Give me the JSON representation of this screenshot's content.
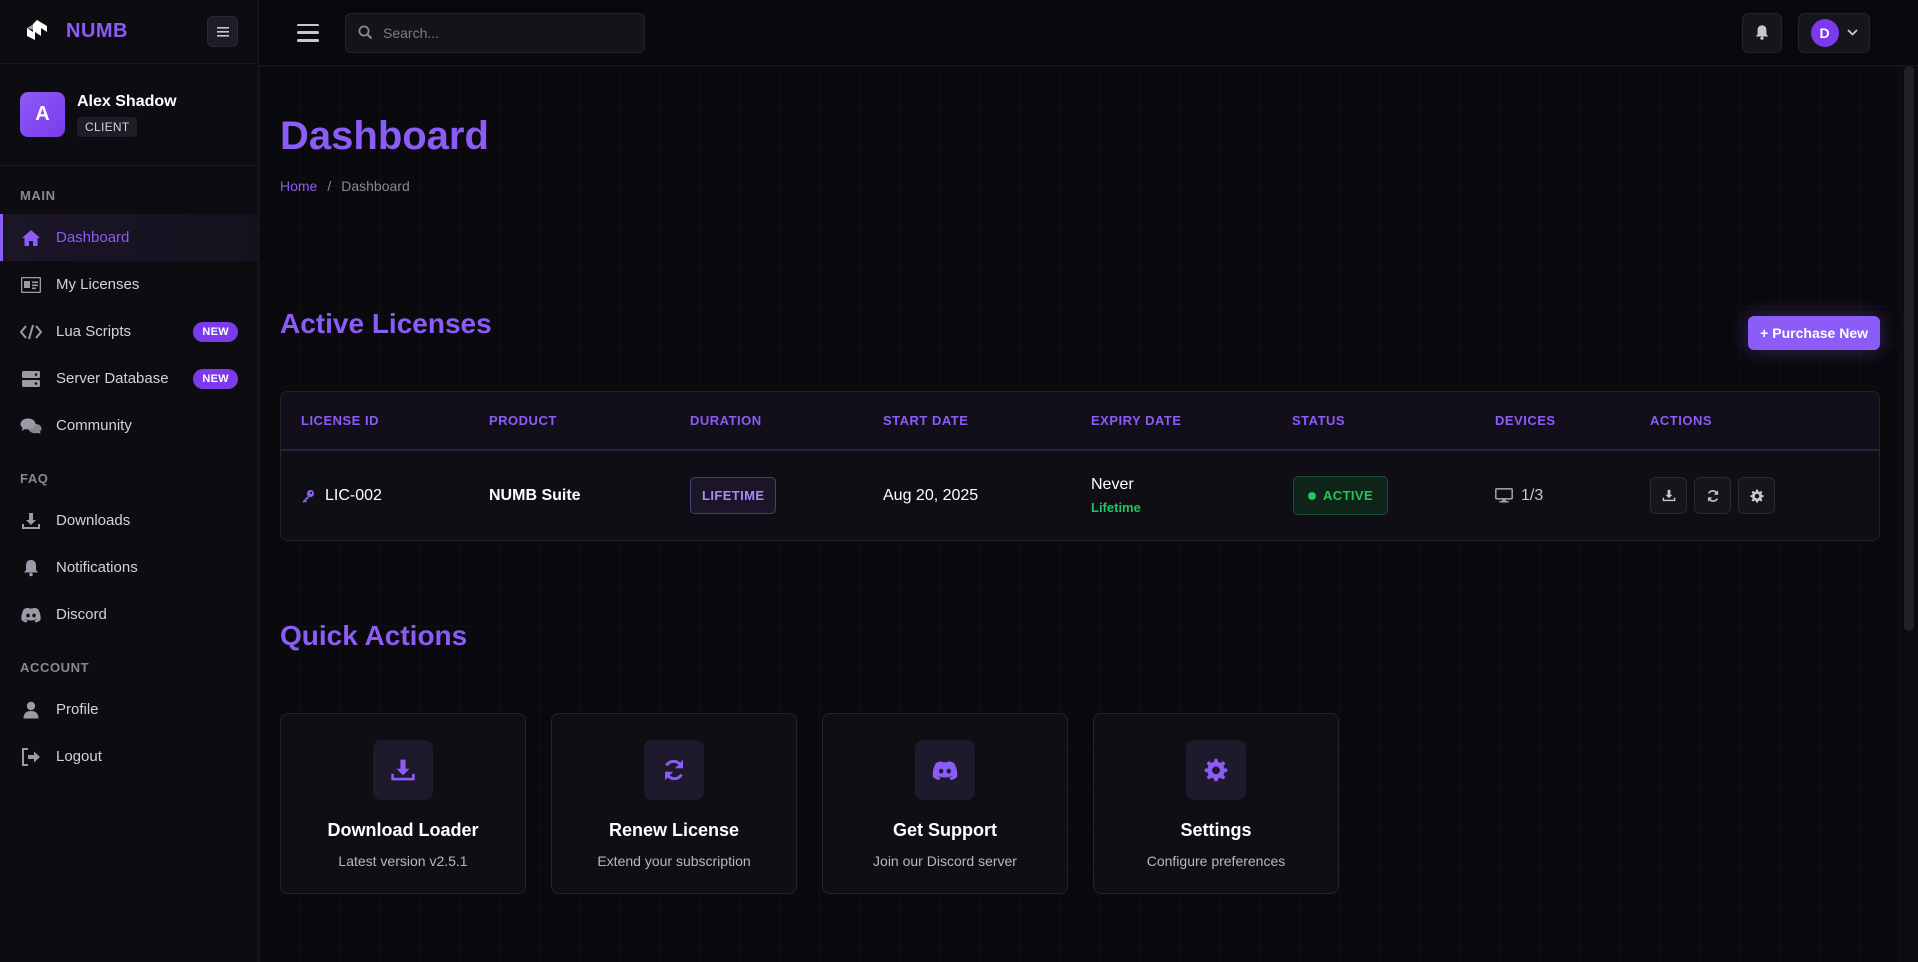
{
  "brand": {
    "name": "NUMB"
  },
  "user": {
    "initial": "A",
    "name": "Alex Shadow",
    "role": "CLIENT"
  },
  "sidebar": {
    "sections": [
      {
        "title": "MAIN",
        "items": [
          {
            "label": "Dashboard",
            "icon": "home-icon",
            "active": true
          },
          {
            "label": "My Licenses",
            "icon": "id-card-icon"
          },
          {
            "label": "Lua Scripts",
            "icon": "code-icon",
            "badge": "NEW"
          },
          {
            "label": "Server Database",
            "icon": "server-icon",
            "badge": "NEW"
          },
          {
            "label": "Community",
            "icon": "comments-icon"
          }
        ]
      },
      {
        "title": "FAQ",
        "items": [
          {
            "label": "Downloads",
            "icon": "download-icon"
          },
          {
            "label": "Notifications",
            "icon": "bell-icon"
          },
          {
            "label": "Discord",
            "icon": "discord-icon"
          }
        ]
      },
      {
        "title": "ACCOUNT",
        "items": [
          {
            "label": "Profile",
            "icon": "user-icon"
          },
          {
            "label": "Logout",
            "icon": "logout-icon"
          }
        ]
      }
    ]
  },
  "topbar": {
    "search_placeholder": "Search...",
    "profile_initial": "D"
  },
  "page": {
    "title": "Dashboard",
    "breadcrumb": {
      "home": "Home",
      "separator": "/",
      "current": "Dashboard"
    }
  },
  "licenses": {
    "title": "Active Licenses",
    "purchase_label": "Purchase New",
    "columns": [
      "LICENSE ID",
      "PRODUCT",
      "DURATION",
      "START DATE",
      "EXPIRY DATE",
      "STATUS",
      "DEVICES",
      "ACTIONS"
    ],
    "rows": [
      {
        "id": "LIC-002",
        "product": "NUMB Suite",
        "duration": "LIFETIME",
        "start_date": "Aug 20, 2025",
        "expiry": "Never",
        "expiry_note": "Lifetime",
        "status": "ACTIVE",
        "devices": "1/3"
      }
    ]
  },
  "quick_actions": {
    "title": "Quick Actions",
    "items": [
      {
        "title": "Download Loader",
        "desc": "Latest version v2.5.1",
        "icon": "download-icon"
      },
      {
        "title": "Renew License",
        "desc": "Extend your subscription",
        "icon": "refresh-icon"
      },
      {
        "title": "Get Support",
        "desc": "Join our Discord server",
        "icon": "discord-icon"
      },
      {
        "title": "Settings",
        "desc": "Configure preferences",
        "icon": "gear-icon"
      }
    ]
  },
  "colors": {
    "accent": "#8b5cf6",
    "success": "#22c55e",
    "background": "#0a090d"
  }
}
